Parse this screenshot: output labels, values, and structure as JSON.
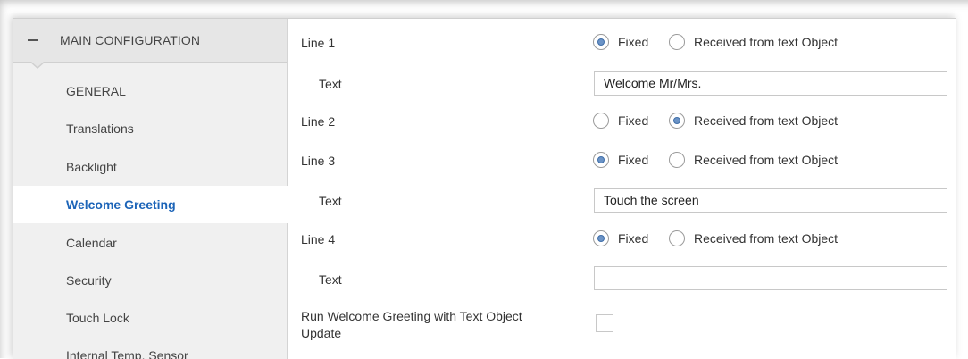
{
  "sidebar": {
    "header_title": "MAIN CONFIGURATION",
    "items": [
      {
        "label": "GENERAL"
      },
      {
        "label": "Translations"
      },
      {
        "label": "Backlight"
      },
      {
        "label": "Welcome Greeting"
      },
      {
        "label": "Calendar"
      },
      {
        "label": "Security"
      },
      {
        "label": "Touch Lock"
      },
      {
        "label": "Internal Temp. Sensor"
      }
    ]
  },
  "form": {
    "line1": {
      "label": "Line 1",
      "options": [
        "Fixed",
        "Received from text Object"
      ],
      "selected": "Fixed",
      "text_label": "Text",
      "text_value": "Welcome Mr/Mrs."
    },
    "line2": {
      "label": "Line 2",
      "options": [
        "Fixed",
        "Received from text Object"
      ],
      "selected": "Received from text Object"
    },
    "line3": {
      "label": "Line 3",
      "options": [
        "Fixed",
        "Received from text Object"
      ],
      "selected": "Fixed",
      "text_label": "Text",
      "text_value": "Touch the screen"
    },
    "line4": {
      "label": "Line 4",
      "options": [
        "Fixed",
        "Received from text Object"
      ],
      "selected": "Fixed",
      "text_label": "Text",
      "text_value": ""
    },
    "run_update": {
      "label_line1": "Run Welcome Greeting with Text Object",
      "label_line2": "Update",
      "checked": false
    }
  },
  "colors": {
    "active_item": "#1c64b8",
    "radio_dot": "#6b93c6"
  }
}
